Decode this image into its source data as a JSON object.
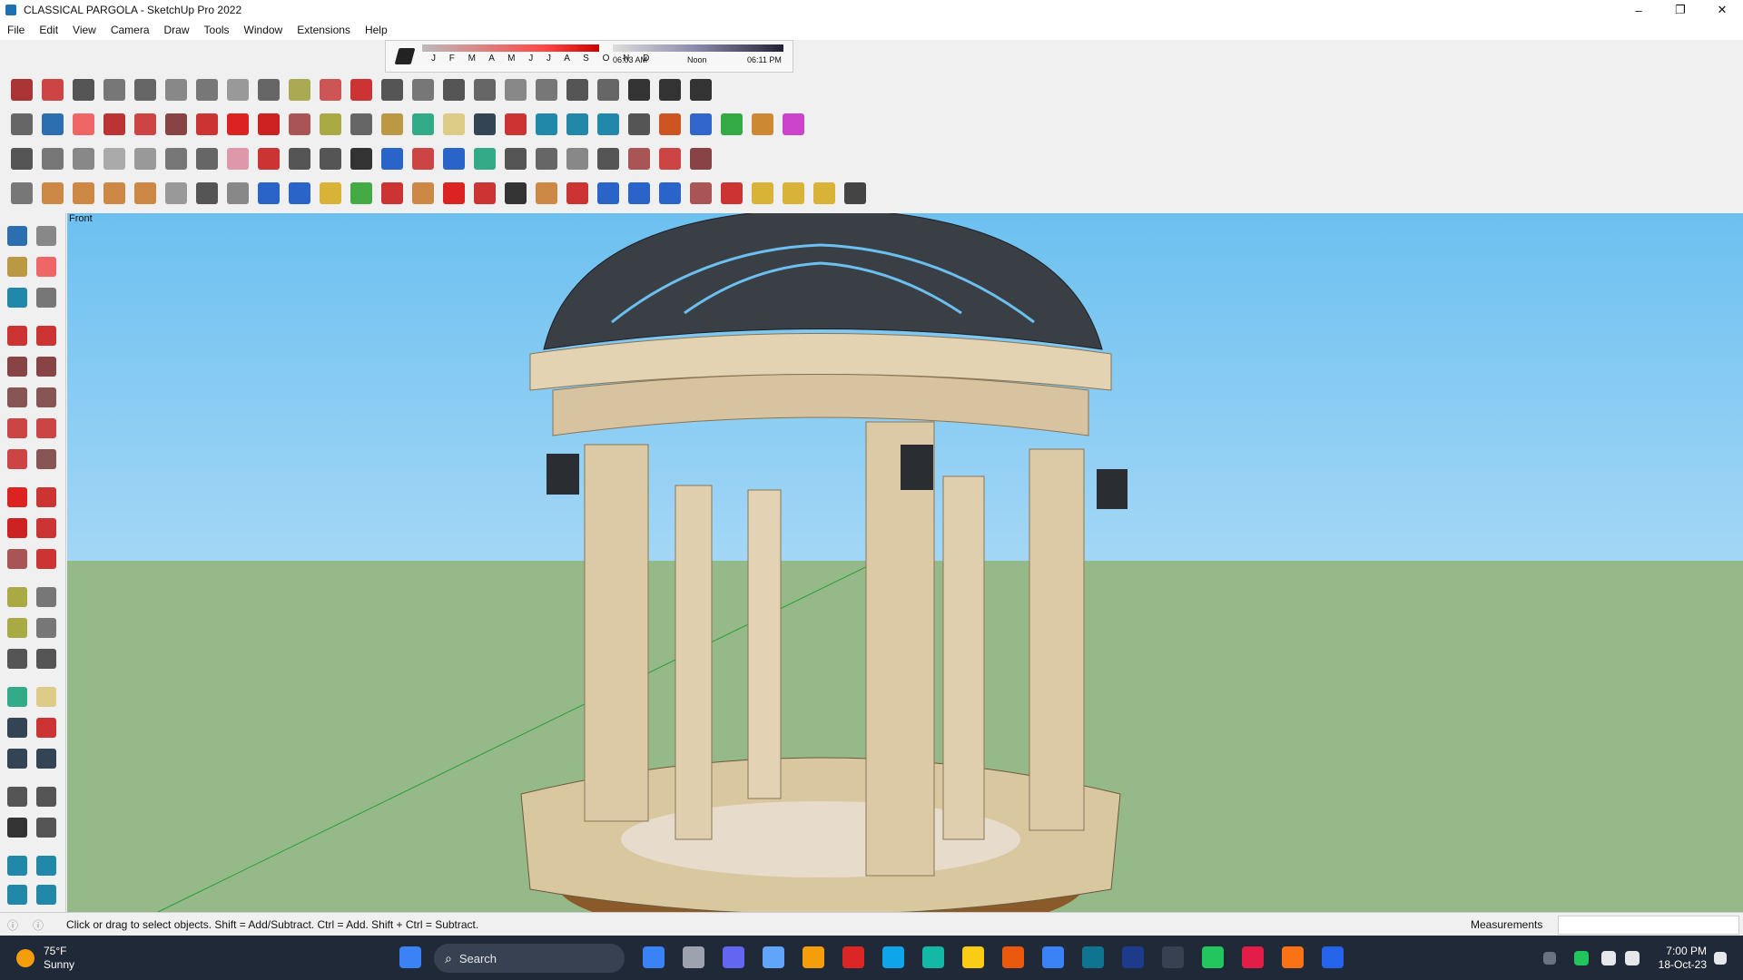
{
  "window": {
    "title": "CLASSICAL PARGOLA - SketchUp Pro 2022",
    "minimize": "–",
    "maximize": "❐",
    "close": "✕"
  },
  "menu": [
    "File",
    "Edit",
    "View",
    "Camera",
    "Draw",
    "Tools",
    "Window",
    "Extensions",
    "Help"
  ],
  "shadow": {
    "months": "J F M A M J J A S O N D",
    "time_start": "06:03 AM",
    "time_mid": "Noon",
    "time_end": "06:11 PM"
  },
  "viewport": {
    "scene_label": "Front",
    "colors": {
      "sky_top": "#6cc0f0",
      "ground": "#96b98a"
    }
  },
  "status": {
    "message": "Click or drag to select objects. Shift = Add/Subtract. Ctrl = Add. Shift + Ctrl = Subtract.",
    "measurements_label": "Measurements",
    "measurements_value": ""
  },
  "taskbar": {
    "weather_temp": "75°F",
    "weather_desc": "Sunny",
    "search_placeholder": "Search",
    "time": "7:00 PM",
    "date": "18-Oct-23"
  }
}
